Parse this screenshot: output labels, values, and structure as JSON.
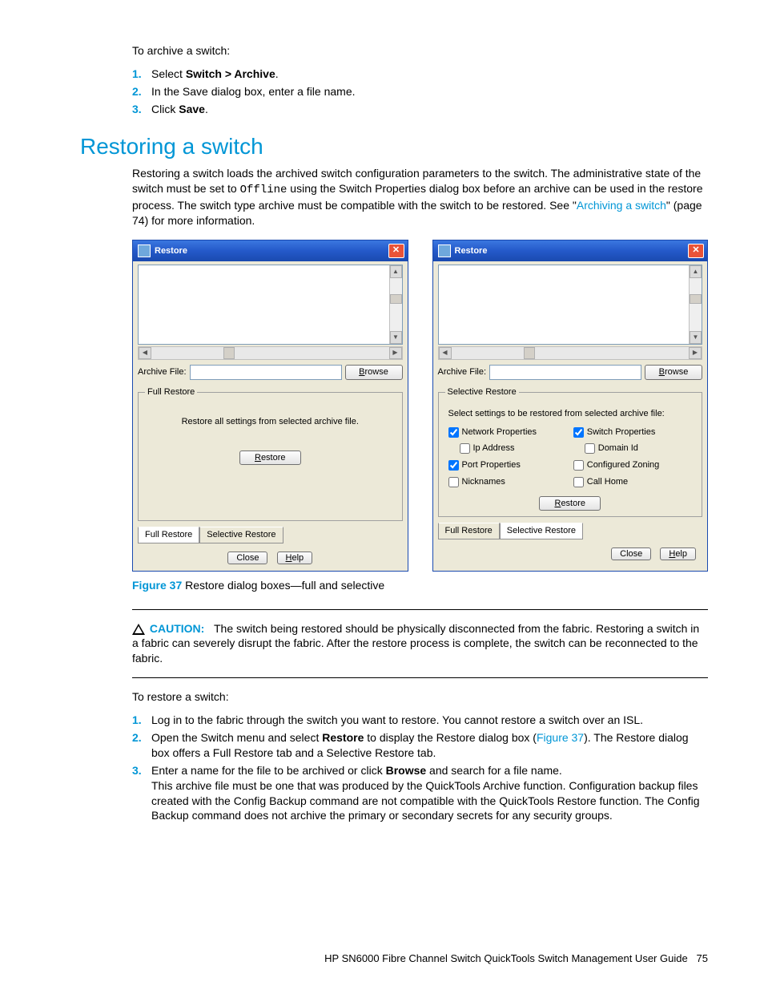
{
  "intro_archive": "To archive a switch:",
  "archive_steps": {
    "s1a": "Select ",
    "s1b": "Switch > Archive",
    "s1c": ".",
    "s2": "In the Save dialog box, enter a file name.",
    "s3a": "Click ",
    "s3b": "Save",
    "s3c": "."
  },
  "heading": "Restoring a switch",
  "para1a": "Restoring a switch loads the archived switch configuration parameters to the switch. The administrative state of the switch must be set to ",
  "para1_code": "Offline",
  "para1b": " using the Switch Properties dialog box before an archive can be used in the restore process. The switch type archive must be compatible with the switch to be restored. See \"",
  "para1_link": "Archiving a switch",
  "para1c": "\" (page 74) for more information.",
  "dialog": {
    "title": "Restore",
    "archive_file_label": "Archive File:",
    "browse_u": "B",
    "browse_rest": "rowse",
    "full_legend": "Full Restore",
    "full_text": "Restore all settings from selected archive file.",
    "restore_btn_u": "R",
    "restore_btn_rest": "estore",
    "tab_full": "Full Restore",
    "tab_selective": "Selective Restore",
    "close": "Close",
    "help_u": "H",
    "help_rest": "elp",
    "sel_legend": "Selective Restore",
    "sel_instr": "Select settings to be restored from selected archive file:",
    "c_network": "Network Properties",
    "c_switch": "Switch Properties",
    "c_ip": "Ip Address",
    "c_domain": "Domain Id",
    "c_port": "Port Properties",
    "c_zoning": "Configured Zoning",
    "c_nick": "Nicknames",
    "c_call": "Call Home"
  },
  "figure": {
    "label": "Figure 37",
    "caption": " Restore dialog boxes—full and selective"
  },
  "caution": {
    "label": "CAUTION:",
    "text": "The switch being restored should be physically disconnected from the fabric. Restoring a switch in a fabric can severely disrupt the fabric. After the restore process is complete, the switch can be reconnected to the fabric."
  },
  "intro_restore": "To restore a switch:",
  "restore_steps": {
    "s1": "Log in to the fabric through the switch you want to restore. You cannot restore a switch over an ISL.",
    "s2a": "Open the Switch menu and select ",
    "s2b": "Restore",
    "s2c": " to display the Restore dialog box (",
    "s2link": "Figure 37",
    "s2d": "). The Restore dialog box offers a Full Restore tab and a Selective Restore tab.",
    "s3a": "Enter a name for the file to be archived or click ",
    "s3b": "Browse",
    "s3c": " and search for a file name.",
    "s3d": "This archive file must be one that was produced by the QuickTools Archive function. Configuration backup files created with the Config Backup command are not compatible with the QuickTools Restore function. The Config Backup command does not archive the primary or secondary secrets for any security groups."
  },
  "footer": {
    "text": "HP SN6000 Fibre Channel Switch QuickTools Switch Management User Guide",
    "page": "75"
  }
}
